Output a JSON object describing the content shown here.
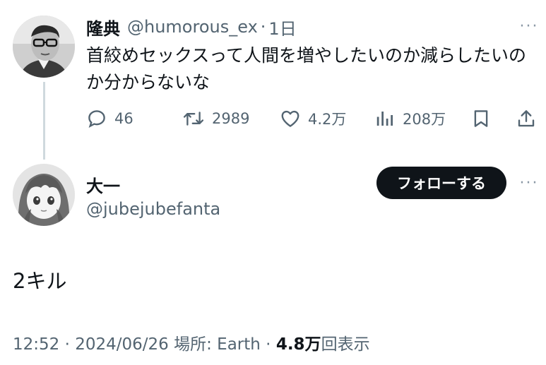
{
  "parent_tweet": {
    "display_name": "隆典",
    "handle": "@humorous_ex",
    "separator": "·",
    "time": "1日",
    "text": "首絞めセックスって人間を増やしたいのか減らしたいのか分からないな",
    "more_label": "···",
    "avatar_icon": "user-photo-icon",
    "actions": {
      "reply_count": "46",
      "retweet_count": "2989",
      "like_count": "4.2万",
      "views_count": "208万"
    }
  },
  "main_tweet": {
    "display_name": "大一",
    "handle": "@jubejubefanta",
    "follow_label": "フォローする",
    "more_label": "···",
    "avatar_icon": "anime-girl-avatar-icon",
    "text": "2キル",
    "meta": {
      "time": "12:52",
      "sep1": " · ",
      "date": "2024/06/26",
      "location_label": " 場所: Earth",
      "sep2": " · ",
      "views_count": "4.8万",
      "views_suffix": "回表示"
    }
  },
  "colors": {
    "text_primary": "#0f1419",
    "text_secondary": "#536471",
    "thread_line": "#cfd9de",
    "follow_button_bg": "#0f1419"
  }
}
